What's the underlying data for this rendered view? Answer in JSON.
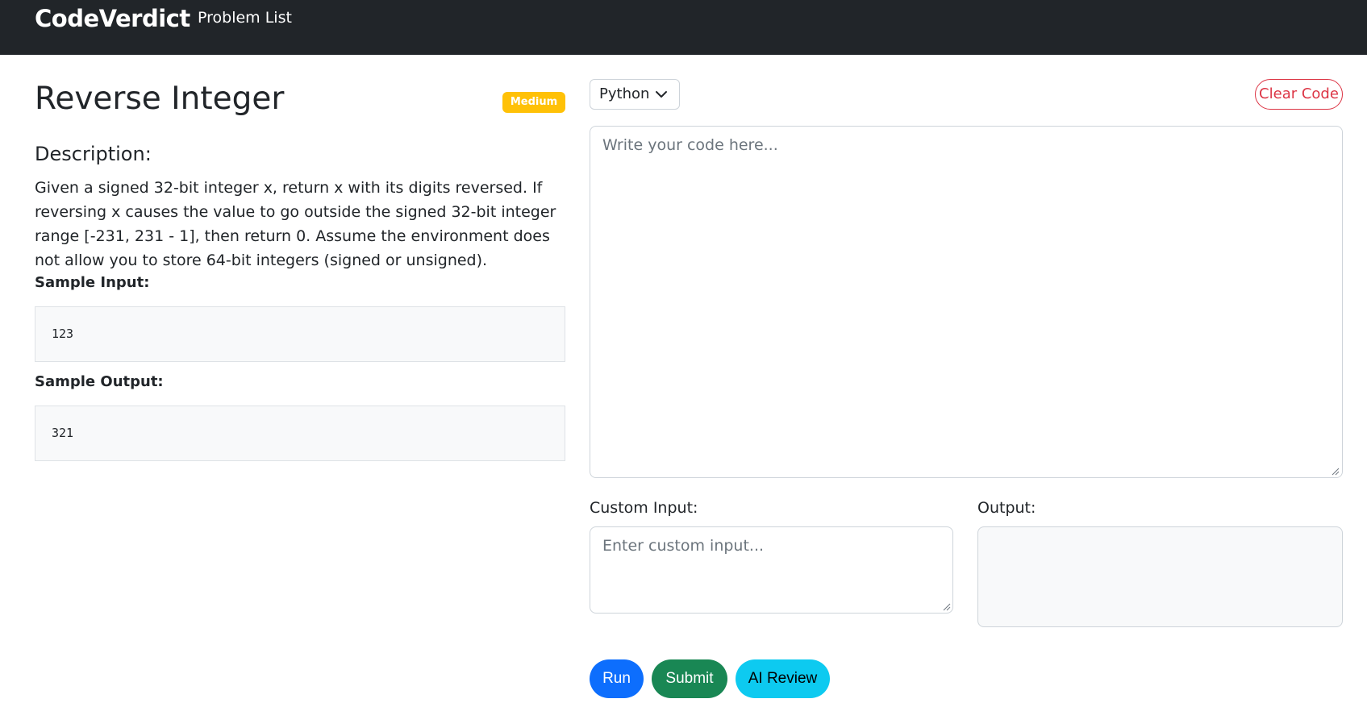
{
  "navbar": {
    "brand": "CodeVerdict",
    "links": [
      "Problem List"
    ]
  },
  "problem": {
    "title": "Reverse Integer",
    "difficulty": "Medium",
    "description_heading": "Description:",
    "description": "Given a signed 32-bit integer x, return x with its digits reversed. If reversing x causes the value to go outside the signed 32-bit integer range [-231, 231 - 1], then return 0. Assume the environment does not allow you to store 64-bit integers (signed or unsigned).",
    "sample_input_label": "Sample Input:",
    "sample_input": "123",
    "sample_output_label": "Sample Output:",
    "sample_output": "321"
  },
  "editor": {
    "language": "Python",
    "language_icon": "chevron-down-icon",
    "clear_label": "Clear Code",
    "code_value": "",
    "code_placeholder": "Write your code here...",
    "custom_input_label": "Custom Input:",
    "custom_input_value": "",
    "custom_input_placeholder": "Enter custom input...",
    "output_label": "Output:",
    "output_value": ""
  },
  "actions": {
    "run": "Run",
    "submit": "Submit",
    "ai_review": "AI Review"
  },
  "colors": {
    "navbar_bg": "#212529",
    "badge_medium": "#ffc107",
    "run": "#0d6efd",
    "submit": "#198754",
    "ai_review": "#0dcaf0",
    "clear": "#dc3545"
  }
}
